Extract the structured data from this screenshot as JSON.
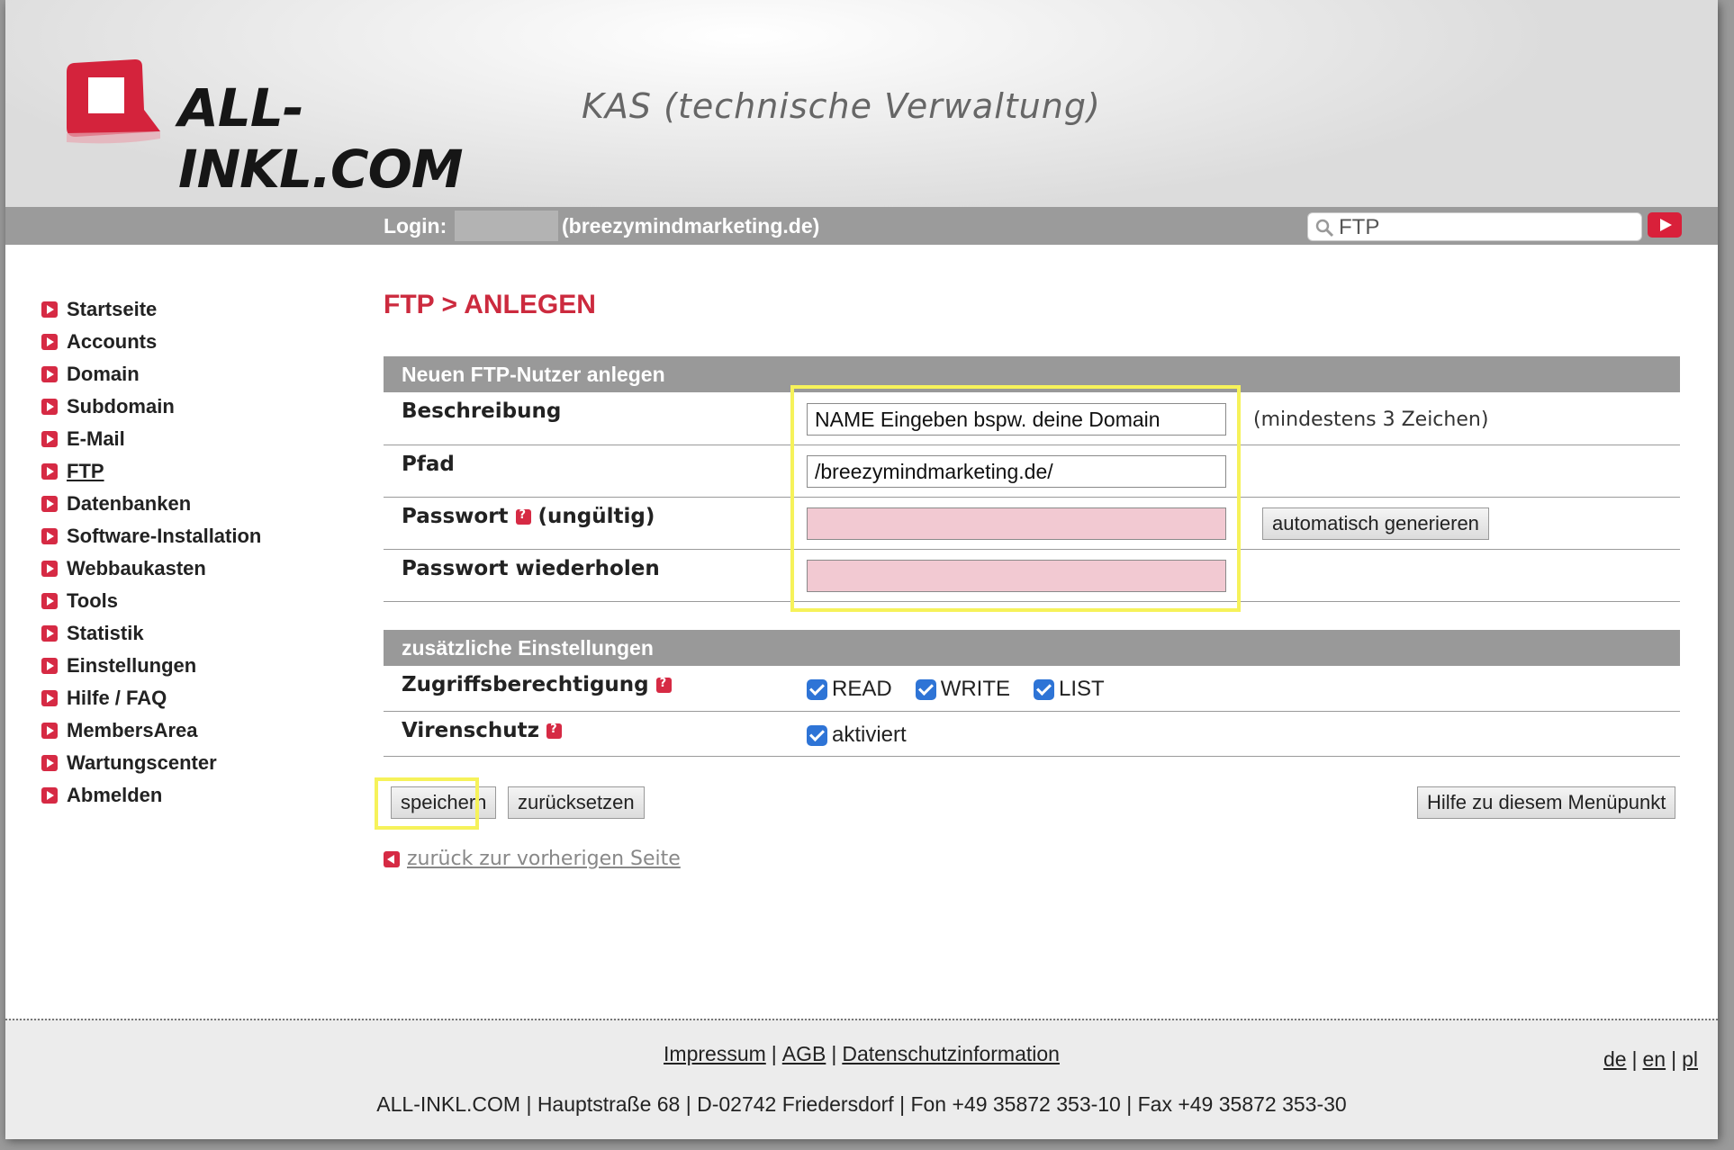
{
  "header": {
    "brand": "ALL-INKL.COM",
    "tagline": "KAS (technische Verwaltung)"
  },
  "login_bar": {
    "label": "Login:",
    "domain": "(breezymindmarketing.de)",
    "search_value": "FTP"
  },
  "sidebar": {
    "items": [
      {
        "label": "Startseite"
      },
      {
        "label": "Accounts"
      },
      {
        "label": "Domain"
      },
      {
        "label": "Subdomain"
      },
      {
        "label": "E-Mail"
      },
      {
        "label": "FTP",
        "current": true
      },
      {
        "label": "Datenbanken"
      },
      {
        "label": "Software-Installation"
      },
      {
        "label": "Webbaukasten"
      },
      {
        "label": "Tools"
      },
      {
        "label": "Statistik"
      },
      {
        "label": "Einstellungen"
      },
      {
        "label": "Hilfe / FAQ"
      },
      {
        "label": "MembersArea"
      },
      {
        "label": "Wartungscenter"
      },
      {
        "label": "Abmelden"
      }
    ]
  },
  "main": {
    "title": "FTP > ANLEGEN",
    "section1": {
      "heading": "Neuen FTP-Nutzer anlegen",
      "description_label": "Beschreibung",
      "description_value": "NAME Eingeben bspw. deine Domain",
      "description_hint": "(mindestens 3 Zeichen)",
      "path_label": "Pfad",
      "path_value": "/breezymindmarketing.de/",
      "password_label": "Passwort",
      "password_status": "(ungültig)",
      "generate_button": "automatisch generieren",
      "password_repeat_label": "Passwort wiederholen"
    },
    "section2": {
      "heading": "zusätzliche Einstellungen",
      "access_label": "Zugriffsberechtigung",
      "access_options": [
        {
          "label": "READ",
          "checked": true
        },
        {
          "label": "WRITE",
          "checked": true
        },
        {
          "label": "LIST",
          "checked": true
        }
      ],
      "virus_label": "Virenschutz",
      "virus_option": {
        "label": "aktiviert",
        "checked": true
      }
    },
    "buttons": {
      "save": "speichern",
      "reset": "zurücksetzen",
      "help": "Hilfe zu diesem Menüpunkt"
    },
    "back_link": "zurück zur vorherigen Seite"
  },
  "footer": {
    "links": [
      "Impressum",
      "AGB",
      "Datenschutzinformation"
    ],
    "languages": [
      "de",
      "en",
      "pl"
    ],
    "address": "ALL-INKL.COM | Hauptstraße 68 | D-02742 Friedersdorf | Fon +49 35872 353-10 | Fax +49 35872 353-30"
  },
  "colors": {
    "accent": "#cc2a3e",
    "bar_gray": "#9b9b9b",
    "invalid_field": "#f2c9d2",
    "highlight": "#f6f25a"
  }
}
